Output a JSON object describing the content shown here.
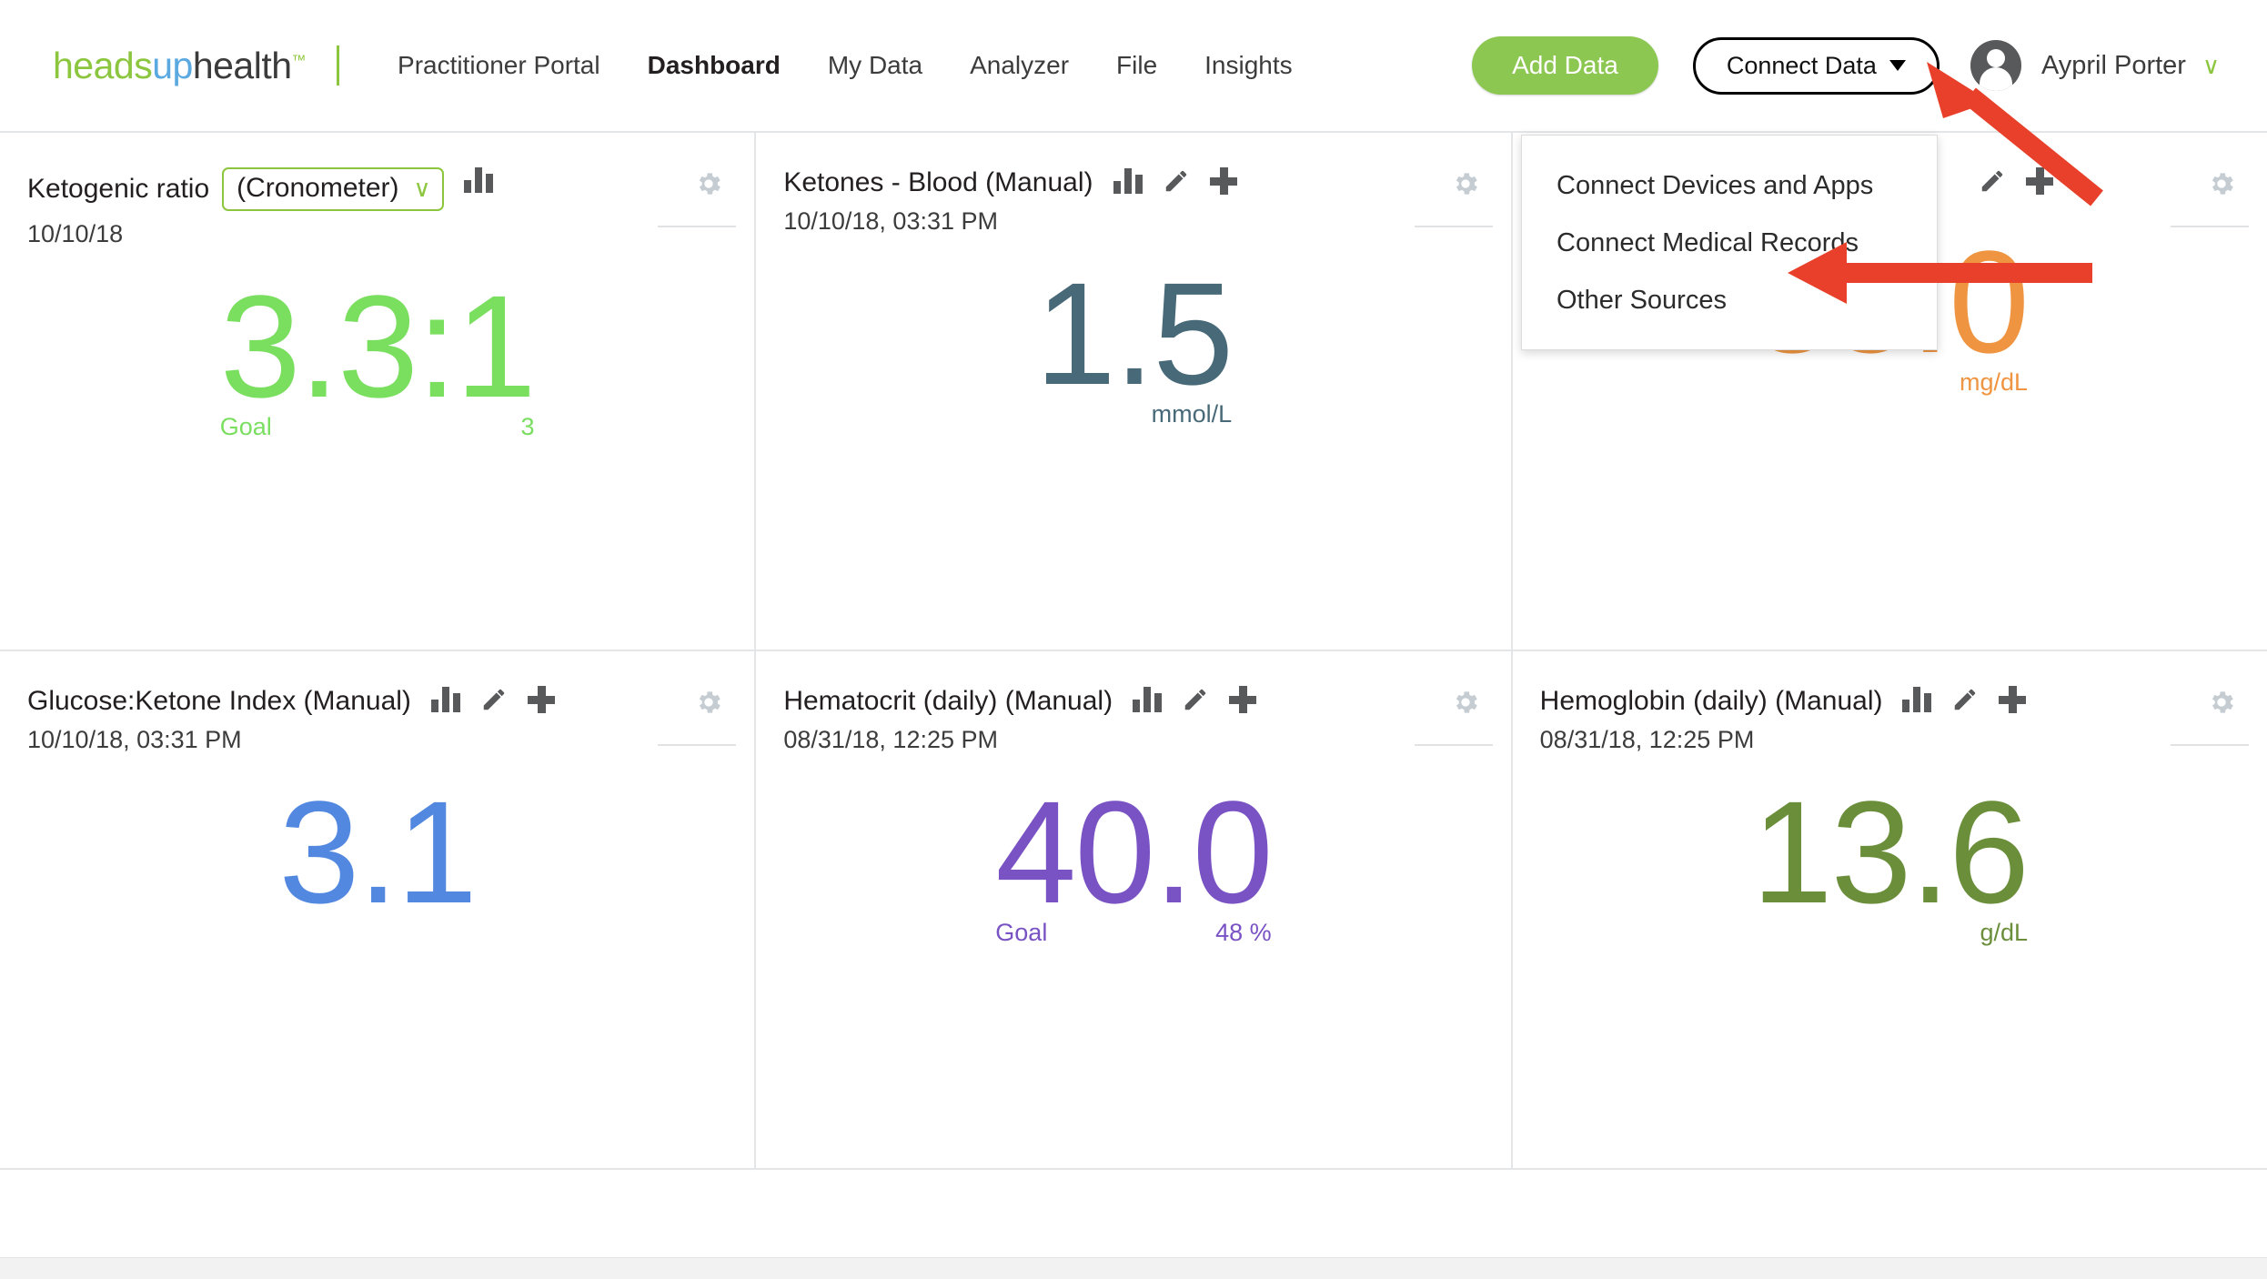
{
  "brand": {
    "logo_part1": "heads",
    "logo_part2": "up",
    "logo_part3": "health",
    "logo_tm": "™",
    "green": "#8cc63e",
    "blue": "#5aa9e0",
    "dark": "#3b3b3b"
  },
  "nav": {
    "items": [
      {
        "label": "Practitioner Portal",
        "active": false
      },
      {
        "label": "Dashboard",
        "active": true
      },
      {
        "label": "My Data",
        "active": false
      },
      {
        "label": "Analyzer",
        "active": false
      },
      {
        "label": "File",
        "active": false
      },
      {
        "label": "Insights",
        "active": false
      }
    ]
  },
  "header": {
    "add_data_label": "Add Data",
    "connect_data_label": "Connect Data",
    "username": "Aypril Porter",
    "user_caret": "∨",
    "add_button_color": "#8cc751"
  },
  "dropdown": {
    "open": true,
    "items": [
      {
        "label": "Connect Devices and Apps"
      },
      {
        "label": "Connect Medical Records"
      },
      {
        "label": "Other Sources"
      }
    ]
  },
  "cards": [
    {
      "title": "Ketogenic ratio",
      "has_select": true,
      "select_value": "(Cronometer)",
      "date": "10/10/18",
      "value": "3.3:1",
      "color": "#7ade5f",
      "goal_label": "Goal",
      "goal_value": "3",
      "unit": "",
      "icons": [
        "bar-chart"
      ],
      "gear": true
    },
    {
      "title": "Ketones - Blood (Manual)",
      "has_select": false,
      "select_value": "",
      "date": "10/10/18, 03:31 PM",
      "value": "1.5",
      "color": "#486a78",
      "goal_label": "",
      "goal_value": "",
      "unit": "mmol/L",
      "icons": [
        "bar-chart",
        "pencil",
        "plus"
      ],
      "gear": true
    },
    {
      "title": "",
      "has_select": false,
      "select_value": "",
      "date": "",
      "value": "85.0",
      "color": "#ef9440",
      "goal_label": "",
      "goal_value": "",
      "unit": "mg/dL",
      "icons": [
        "pencil",
        "plus"
      ],
      "gear": true
    },
    {
      "title": "Glucose:Ketone Index (Manual)",
      "has_select": false,
      "select_value": "",
      "date": "10/10/18, 03:31 PM",
      "value": "3.1",
      "color": "#5288e0",
      "goal_label": "",
      "goal_value": "",
      "unit": "",
      "icons": [
        "bar-chart",
        "pencil",
        "plus"
      ],
      "gear": true
    },
    {
      "title": "Hematocrit (daily) (Manual)",
      "has_select": false,
      "select_value": "",
      "date": "08/31/18, 12:25 PM",
      "value": "40.0",
      "color": "#7952c4",
      "goal_label": "Goal",
      "goal_value": "48 %",
      "unit": "",
      "icons": [
        "bar-chart",
        "pencil",
        "plus"
      ],
      "gear": true
    },
    {
      "title": "Hemoglobin (daily) (Manual)",
      "has_select": false,
      "select_value": "",
      "date": "08/31/18, 12:25 PM",
      "value": "13.6",
      "color": "#6b8e3a",
      "goal_label": "",
      "goal_value": "",
      "unit": "g/dL",
      "icons": [
        "bar-chart",
        "pencil",
        "plus"
      ],
      "gear": true
    }
  ],
  "annotations": {
    "arrow_color": "#e8402a",
    "arrows": [
      {
        "name": "arrow-to-connect-data",
        "target": "Connect Data"
      },
      {
        "name": "arrow-to-other-sources",
        "target": "Other Sources"
      }
    ]
  }
}
